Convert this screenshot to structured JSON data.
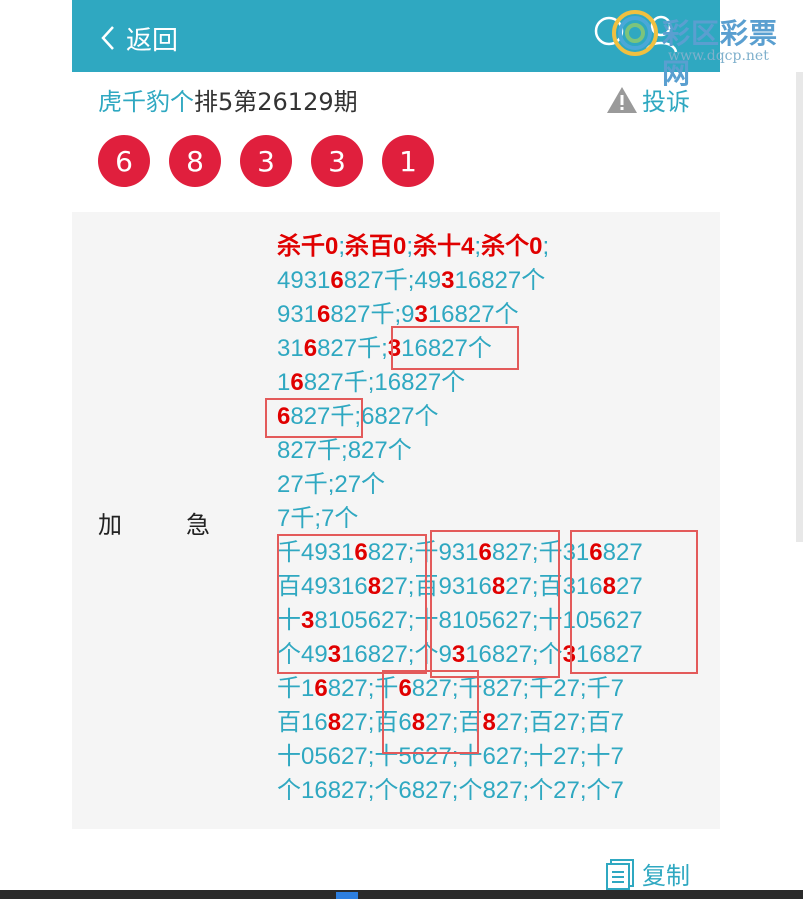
{
  "header": {
    "back_label": "返回",
    "watermark_text": "彩区彩票网",
    "watermark_url": "www.dqcp.net"
  },
  "title": {
    "link_part": "虎千豹个",
    "rest": "排5第26129期"
  },
  "complaint_label": "投诉",
  "balls": [
    "6",
    "8",
    "3",
    "3",
    "1"
  ],
  "panel_label_1": "加",
  "panel_label_2": "急",
  "lines": [
    [
      {
        "t": "杀千0",
        "r": true
      },
      {
        "t": ";"
      },
      {
        "t": "杀百0",
        "r": true
      },
      {
        "t": ";"
      },
      {
        "t": "杀十4",
        "r": true
      },
      {
        "t": ";"
      },
      {
        "t": "杀个0",
        "r": true
      },
      {
        "t": ";"
      }
    ],
    [
      {
        "t": "4931"
      },
      {
        "t": "6",
        "r": true
      },
      {
        "t": "827千;49"
      },
      {
        "t": "3",
        "r": true
      },
      {
        "t": "16827个"
      }
    ],
    [
      {
        "t": "931"
      },
      {
        "t": "6",
        "r": true
      },
      {
        "t": "827千;9"
      },
      {
        "t": "3",
        "r": true
      },
      {
        "t": "16827个"
      }
    ],
    [
      {
        "t": "31"
      },
      {
        "t": "6",
        "r": true
      },
      {
        "t": "827千;"
      },
      {
        "t": "3",
        "r": true
      },
      {
        "t": "16827个"
      }
    ],
    [
      {
        "t": "1"
      },
      {
        "t": "6",
        "r": true
      },
      {
        "t": "827千;16827个"
      }
    ],
    [
      {
        "t": "6",
        "r": true
      },
      {
        "t": "827千;6827个"
      }
    ],
    [
      {
        "t": "827千;827个"
      }
    ],
    [
      {
        "t": "27千;27个"
      }
    ],
    [
      {
        "t": "7千;7个"
      }
    ],
    [
      {
        "t": "千4931"
      },
      {
        "t": "6",
        "r": true
      },
      {
        "t": "827;千931"
      },
      {
        "t": "6",
        "r": true
      },
      {
        "t": "827;千31"
      },
      {
        "t": "6",
        "r": true
      },
      {
        "t": "827"
      }
    ],
    [
      {
        "t": "百49316"
      },
      {
        "t": "8",
        "r": true
      },
      {
        "t": "27;百9316"
      },
      {
        "t": "8",
        "r": true
      },
      {
        "t": "27;百316"
      },
      {
        "t": "8",
        "r": true
      },
      {
        "t": "27"
      }
    ],
    [
      {
        "t": "十"
      },
      {
        "t": "3",
        "r": true
      },
      {
        "t": "8105627;十8105627;十105627"
      }
    ],
    [
      {
        "t": "个49"
      },
      {
        "t": "3",
        "r": true
      },
      {
        "t": "16827;个9"
      },
      {
        "t": "3",
        "r": true
      },
      {
        "t": "16827;个"
      },
      {
        "t": "3",
        "r": true
      },
      {
        "t": "16827"
      }
    ],
    [
      {
        "t": "千1"
      },
      {
        "t": "6",
        "r": true
      },
      {
        "t": "827;千"
      },
      {
        "t": "6",
        "r": true
      },
      {
        "t": "827;千827;千27;千7"
      }
    ],
    [
      {
        "t": "百16"
      },
      {
        "t": "8",
        "r": true
      },
      {
        "t": "27;百6"
      },
      {
        "t": "8",
        "r": true
      },
      {
        "t": "27;百"
      },
      {
        "t": "8",
        "r": true
      },
      {
        "t": "27;百27;百7"
      }
    ],
    [
      {
        "t": "十05627;十5627;十627;十27;十7"
      }
    ],
    [
      {
        "t": "个16827;个6827;个827;个27;个7"
      }
    ]
  ],
  "copy_label": "复制",
  "colors": {
    "accent": "#2fa8c1",
    "ball": "#e01f3d",
    "highlight": "#e00000",
    "box": "#e35a5a"
  }
}
